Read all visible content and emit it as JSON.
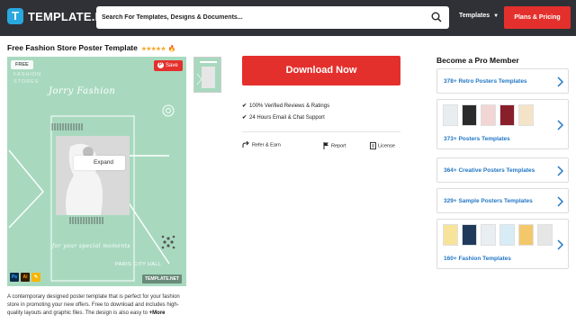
{
  "header": {
    "logo_text": "TEMPLATE.NET",
    "logo_mark": "T",
    "search_placeholder": "Search For Templates, Designs & Documents...",
    "templates_menu": "Templates",
    "plans_button": "Plans & Pricing"
  },
  "product": {
    "title": "Free Fashion Store Poster Template",
    "stars": "★★★★★",
    "fire": "🔥",
    "badge": "FREE",
    "save_label": "Save",
    "save_icon_letter": "P",
    "expand_label": "Expand",
    "description": "A contemporary designed poster template that is perfect for your fashion store in promoting your new offers. Free to download and includes high-quality layouts and graphic files. The design is also easy to",
    "more_label": "+More"
  },
  "poster": {
    "title": "Jorry Fashion",
    "stores_line1": "FASHION",
    "stores_line2": "STORES",
    "special": "for your special moments",
    "venue": "PARIS CITY HALL",
    "watermark": "TEMPLATE.NET",
    "app_ps": "Ps",
    "app_ai": "Ai",
    "app_other": "✎"
  },
  "actions": {
    "download": "Download Now",
    "feature1": "100% Verified Reviews & Ratings",
    "feature2": "24 Hours Email & Chat Support",
    "check": "✔",
    "refer": "Refer & Earn",
    "report": "Report",
    "license": "License"
  },
  "pro": {
    "title": "Become a Pro Member",
    "cards": [
      {
        "label": "378+ Retro Posters Templates"
      },
      {
        "label": "373+ Posters Templates"
      },
      {
        "label": "364+ Creative Posters Templates"
      },
      {
        "label": "329+ Sample Posters Templates"
      },
      {
        "label": "160+ Fashion Templates"
      }
    ]
  },
  "colors": {
    "header_bg": "#2f3136",
    "accent_red": "#e4302c",
    "link_blue": "#2277c5",
    "poster_green": "#a8d9bf"
  }
}
